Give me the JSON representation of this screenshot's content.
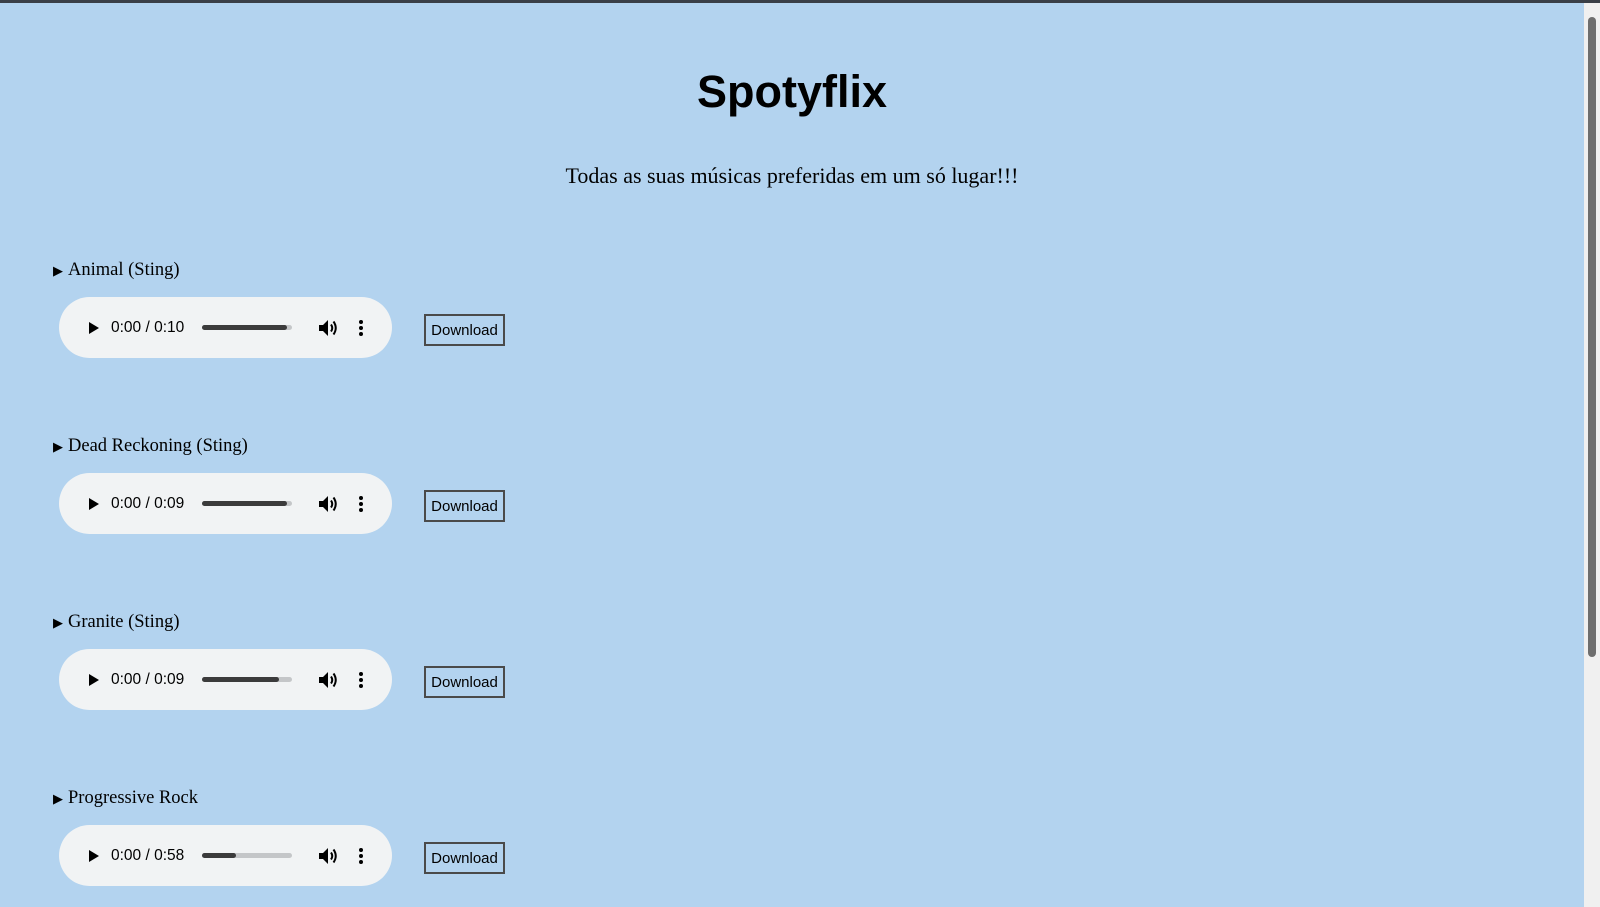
{
  "page": {
    "title": "Spotyflix",
    "subtitle": "Todas as suas músicas preferidas em um só lugar!!!"
  },
  "tracks": [
    {
      "label": "Animal (Sting)",
      "time": "0:00 / 0:10",
      "buffered_fraction": 0.94,
      "download_label": "Download"
    },
    {
      "label": "Dead Reckoning (Sting)",
      "time": "0:00 / 0:09",
      "buffered_fraction": 0.94,
      "download_label": "Download"
    },
    {
      "label": "Granite (Sting)",
      "time": "0:00 / 0:09",
      "buffered_fraction": 0.86,
      "download_label": "Download"
    },
    {
      "label": "Progressive Rock",
      "time": "0:00 / 0:58",
      "buffered_fraction": 0.38,
      "download_label": "Download"
    }
  ],
  "colors": {
    "background": "#b3d3ef",
    "player_background": "#f1f3f4",
    "seek_filled": "#3b3b3b",
    "seek_track": "#c4c6c8"
  },
  "icons": {
    "expand": "triangle-right-icon",
    "play": "play-icon",
    "volume": "volume-icon",
    "menu": "more-vertical-icon"
  }
}
